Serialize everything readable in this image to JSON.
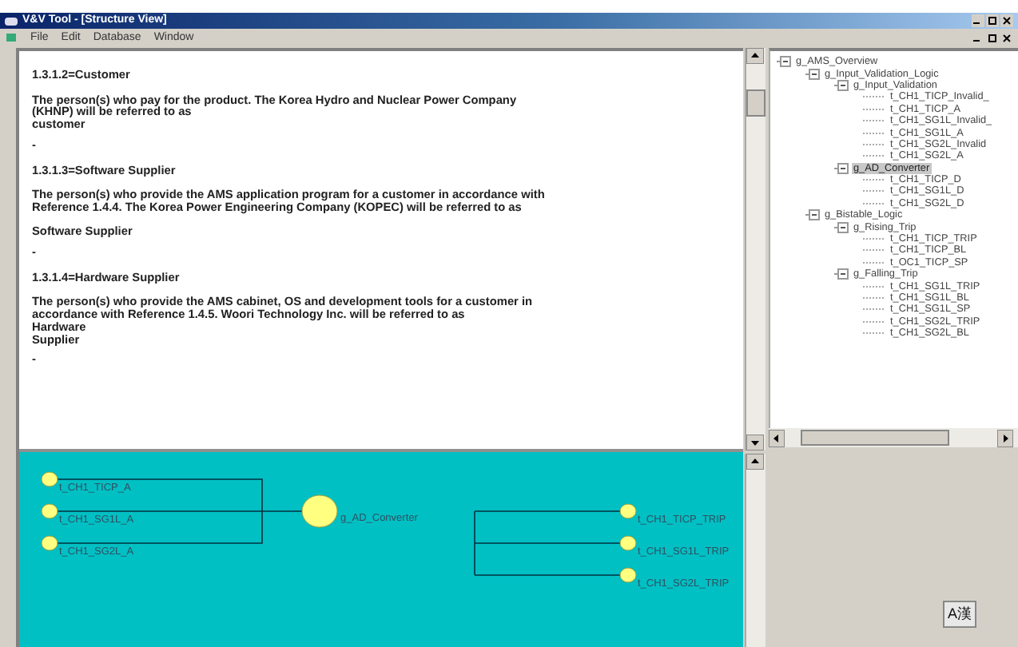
{
  "window": {
    "title": "V&V Tool - [Structure View]"
  },
  "menu": [
    "File",
    "Edit",
    "Database",
    "Window"
  ],
  "document": [
    {
      "kind": "heading",
      "text": "1.3.1.2=Customer"
    },
    {
      "kind": "para",
      "text": "The person(s) who pay for the product.  The Korea Hydro and Nuclear Power Company\n(KHNP) will be referred to as\ncustomer"
    },
    {
      "kind": "dash",
      "text": "-"
    },
    {
      "kind": "heading",
      "text": "1.3.1.3=Software Supplier"
    },
    {
      "kind": "para",
      "text": "The person(s) who provide the AMS application program for a customer in accordance with\nReference 1.4.4.  The Korea Power Engineering Company (KOPEC) will be referred to as\n\nSoftware Supplier"
    },
    {
      "kind": "dash",
      "text": "-"
    },
    {
      "kind": "heading",
      "text": "1.3.1.4=Hardware Supplier"
    },
    {
      "kind": "para",
      "text": "The person(s) who provide the AMS cabinet, OS and development tools for a customer in\naccordance with Reference 1.4.5.  Woori Technology Inc. will be referred to as\nHardware\nSupplier"
    },
    {
      "kind": "dash",
      "text": "-"
    }
  ],
  "tree": [
    {
      "label": "g_AMS_Overview",
      "expanded": true,
      "selected": false,
      "children": [
        {
          "label": "g_Input_Validation_Logic",
          "expanded": true,
          "selected": false,
          "children": [
            {
              "label": "g_Input_Validation",
              "expanded": true,
              "selected": false,
              "children": [
                {
                  "label": "t_CH1_TICP_Invalid_",
                  "selected": false
                },
                {
                  "label": "t_CH1_TICP_A",
                  "selected": false
                },
                {
                  "label": "t_CH1_SG1L_Invalid_",
                  "selected": false
                },
                {
                  "label": "t_CH1_SG1L_A",
                  "selected": false
                },
                {
                  "label": "t_CH1_SG2L_Invalid",
                  "selected": false
                },
                {
                  "label": "t_CH1_SG2L_A",
                  "selected": false
                }
              ]
            },
            {
              "label": "g_AD_Converter",
              "expanded": true,
              "selected": true,
              "children": [
                {
                  "label": "t_CH1_TICP_D",
                  "selected": false
                },
                {
                  "label": "t_CH1_SG1L_D",
                  "selected": false
                },
                {
                  "label": "t_CH1_SG2L_D",
                  "selected": false
                }
              ]
            }
          ]
        },
        {
          "label": "g_Bistable_Logic",
          "expanded": true,
          "selected": false,
          "children": [
            {
              "label": "g_Rising_Trip",
              "expanded": true,
              "selected": false,
              "children": [
                {
                  "label": "t_CH1_TICP_TRIP",
                  "selected": false
                },
                {
                  "label": "t_CH1_TICP_BL",
                  "selected": false
                },
                {
                  "label": "t_OC1_TICP_SP",
                  "selected": false
                }
              ]
            },
            {
              "label": "g_Falling_Trip",
              "expanded": true,
              "selected": false,
              "children": [
                {
                  "label": "t_CH1_SG1L_TRIP",
                  "selected": false
                },
                {
                  "label": "t_CH1_SG1L_BL",
                  "selected": false
                },
                {
                  "label": "t_CH1_SG1L_SP",
                  "selected": false
                },
                {
                  "label": "t_CH1_SG2L_TRIP",
                  "selected": false
                },
                {
                  "label": "t_CH1_SG2L_BL",
                  "selected": false
                }
              ]
            }
          ]
        }
      ]
    }
  ],
  "diagram": {
    "inputs": [
      "t_CH1_TICP_A",
      "t_CH1_SG1L_A",
      "t_CH1_SG2L_A"
    ],
    "converter": "g_AD_Converter",
    "outputs": [
      "t_CH1_TICP_TRIP",
      "t_CH1_SG1L_TRIP",
      "t_CH1_SG2L_TRIP"
    ]
  },
  "ime_indicator": "A漢"
}
